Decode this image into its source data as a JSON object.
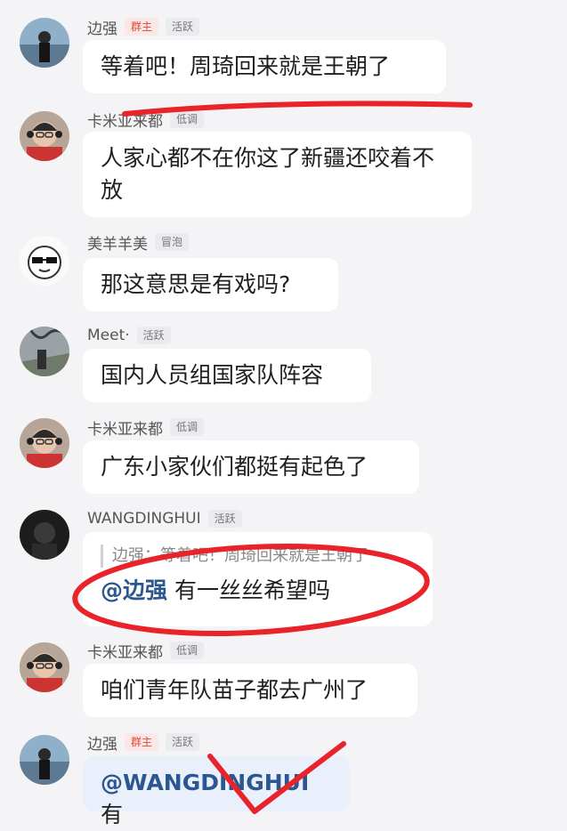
{
  "messages": [
    {
      "name": "边强",
      "badges": [
        {
          "text": "群主",
          "accent": true
        },
        {
          "text": "活跃",
          "accent": false
        }
      ],
      "text": "等着吧！周琦回来就是王朝了"
    },
    {
      "name": "卡米亚来都",
      "badges": [
        {
          "text": "低调",
          "accent": false
        }
      ],
      "text": "人家心都不在你这了新疆还咬着不放"
    },
    {
      "name": "美羊羊美",
      "badges": [
        {
          "text": "冒泡",
          "accent": false
        }
      ],
      "text": "那这意思是有戏吗?"
    },
    {
      "name": "Meet·",
      "badges": [
        {
          "text": "活跃",
          "accent": false
        }
      ],
      "text": "国内人员组国家队阵容"
    },
    {
      "name": "卡米亚来都",
      "badges": [
        {
          "text": "低调",
          "accent": false
        }
      ],
      "text": "广东小家伙们都挺有起色了"
    },
    {
      "name": "WANGDINGHUI",
      "badges": [
        {
          "text": "活跃",
          "accent": false
        }
      ],
      "quote": "边强：等着吧！周琦回来就是王朝了",
      "mention": "@边强",
      "text": "有一丝丝希望吗"
    },
    {
      "name": "卡米亚来都",
      "badges": [
        {
          "text": "低调",
          "accent": false
        }
      ],
      "text": "咱们青年队苗子都去广州了"
    },
    {
      "name": "边强",
      "badges": [
        {
          "text": "群主",
          "accent": true
        },
        {
          "text": "活跃",
          "accent": false
        }
      ],
      "mention": "@WANGDINGHUI",
      "text": "有"
    }
  ],
  "colors": {
    "background": "#f4f4f6",
    "bubble": "#ffffff",
    "mention": "#2b5690",
    "annotation": "#e8232a",
    "owner_badge": "#e0463c"
  },
  "icons": [
    "avatar-photo-court",
    "avatar-glasses-headphones",
    "avatar-cartoon-sunglasses",
    "avatar-photo-tree",
    "avatar-dark"
  ]
}
